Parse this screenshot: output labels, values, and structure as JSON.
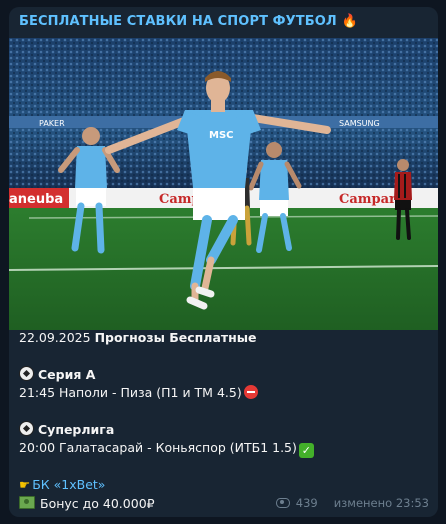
{
  "channel_title": "БЕСПЛАТНЫЕ СТАВКИ НА СПОРТ ФУТБОЛ",
  "title_emoji": "🔥",
  "photo": {
    "ad_boards": [
      "PAKER",
      "SAMSUNG",
      "Campari",
      "aneuba",
      "Campari"
    ],
    "shirt_text": "MSC"
  },
  "post": {
    "date": "22.09.2025",
    "heading": "Прогнозы Бесплатные",
    "leagues": [
      {
        "name": "Серия А",
        "match": "21:45 Наполи - Пиза (П1 и ТМ 4.5)",
        "status_icon": "no-entry"
      },
      {
        "name": "Суперлига",
        "match": "20:00 Галатасарай - Коньяспор (ИТБ1 1.5)",
        "status_icon": "check-mark"
      }
    ],
    "bookmaker_link": "БК «1xBet»",
    "bonus": "Бонус до 40.000₽"
  },
  "footer": {
    "views": "439",
    "edited": "изменено 23:53"
  }
}
